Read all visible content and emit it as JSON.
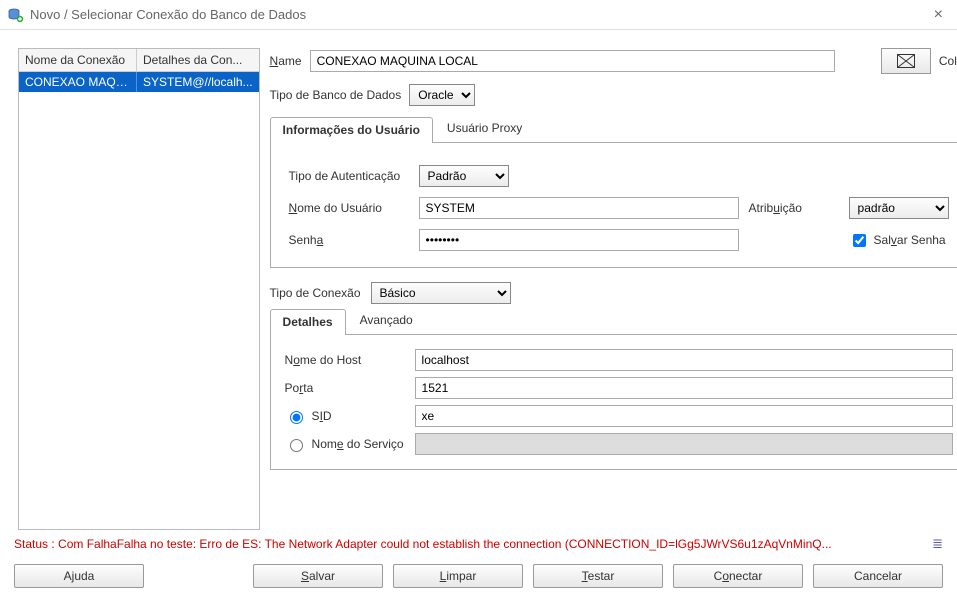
{
  "window": {
    "title": "Novo / Selecionar Conexão do Banco de Dados"
  },
  "left": {
    "col1_header": "Nome da Conexão",
    "col2_header": "Detalhes da Con...",
    "row_name": "CONEXAO MAQU...",
    "row_details": "SYSTEM@//localh..."
  },
  "form": {
    "name_label": "Name",
    "name_value": "CONEXAO MAQUINA LOCAL",
    "color_label": "Color",
    "dbtype_label": "Tipo de Banco de Dados",
    "dbtype_value": "Oracle",
    "tab_user": "Informações do Usuário",
    "tab_proxy": "Usuário Proxy",
    "auth_label": "Tipo de Autenticação",
    "auth_value": "Padrão",
    "user_label": "Nome do Usuário",
    "user_value": "SYSTEM",
    "role_label": "Atribuição",
    "role_value": "padrão",
    "pass_label": "Senha",
    "pass_value": "••••••••",
    "save_pass_label": "Salvar Senha",
    "conn_type_label": "Tipo de Conexão",
    "conn_type_value": "Básico",
    "tab_details": "Detalhes",
    "tab_advanced": "Avançado",
    "host_label": "Nome do Host",
    "host_value": "localhost",
    "port_label": "Porta",
    "port_value": "1521",
    "sid_label": "SID",
    "sid_value": "xe",
    "service_label": "Nome do Serviço",
    "service_value": ""
  },
  "status": {
    "text": "Status : Com FalhaFalha no teste: Erro de ES: The Network Adapter could not establish the connection (CONNECTION_ID=lGg5JWrVS6u1zAqVnMinQ..."
  },
  "buttons": {
    "help": "Ajuda",
    "save": "Salvar",
    "clear": "Limpar",
    "test": "Testar",
    "connect": "Conectar",
    "cancel": "Cancelar"
  }
}
